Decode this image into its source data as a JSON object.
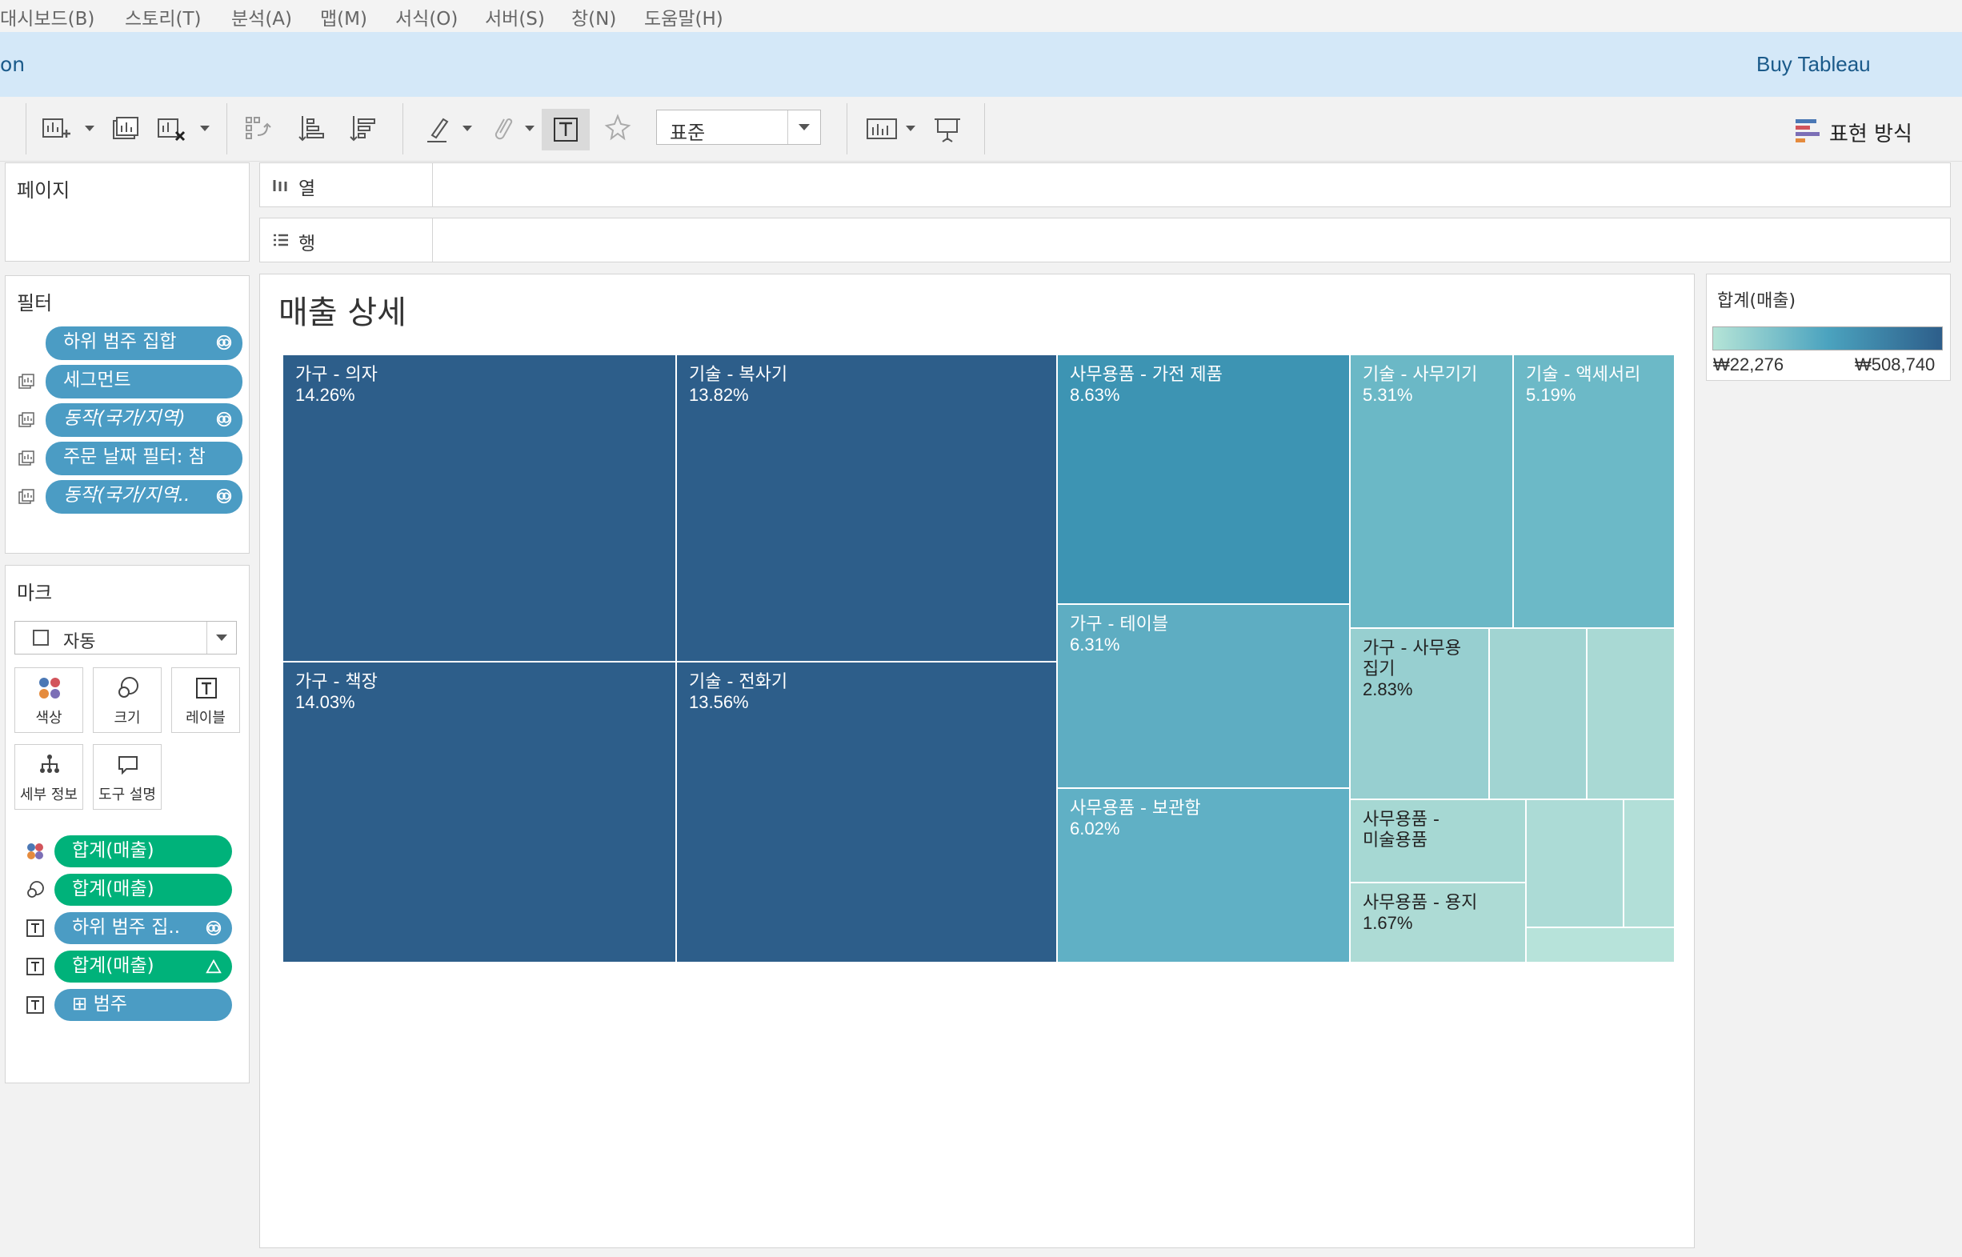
{
  "menu": [
    "대시보드(B)",
    "스토리(T)",
    "분석(A)",
    "맵(M)",
    "서식(O)",
    "서버(S)",
    "창(N)",
    "도움말(H)"
  ],
  "top_strip": {
    "left_text": "on",
    "buy": "Buy Tableau"
  },
  "toolbar": {
    "fit_value": "표준",
    "show_me": "표현 방식",
    "icons": [
      "new-worksheet-icon",
      "duplicate-sheet-icon",
      "clear-sheet-icon",
      "swap-rows-columns-icon",
      "sort-ascending-icon",
      "sort-descending-icon",
      "highlight-icon",
      "attach-icon",
      "show-mark-labels-icon",
      "pin-icon",
      "presentation-chart-icon",
      "present-mode-icon"
    ]
  },
  "shelves": {
    "pages": "페이지",
    "columns": "열",
    "rows": "행"
  },
  "filters": {
    "title": "필터",
    "items": [
      {
        "label": "하위 범주 집합",
        "italic": false,
        "icon": "set-icon",
        "side_icon": ""
      },
      {
        "label": "세그먼트",
        "italic": false,
        "icon": "",
        "side_icon": "context-filter-icon"
      },
      {
        "label": "동작(국가/지역)",
        "italic": true,
        "icon": "set-icon",
        "side_icon": "context-filter-icon"
      },
      {
        "label": "주문 날짜 필터: 참",
        "italic": false,
        "icon": "",
        "side_icon": "context-filter-icon"
      },
      {
        "label": "동작(국가/지역..",
        "italic": true,
        "icon": "set-icon",
        "side_icon": "context-filter-icon"
      }
    ]
  },
  "marks": {
    "title": "마크",
    "type": "자동",
    "buttons": [
      "색상",
      "크기",
      "레이블",
      "세부 정보",
      "도구 설명"
    ],
    "pills": [
      {
        "label": "합계(매출)",
        "color": "green",
        "icon": "color-icon",
        "right_icon": ""
      },
      {
        "label": "합계(매출)",
        "color": "green",
        "icon": "size-icon",
        "right_icon": ""
      },
      {
        "label": "하위 범주 집..",
        "color": "blue",
        "icon": "label-icon",
        "right_icon": "set-icon"
      },
      {
        "label": "합계(매출)",
        "color": "green",
        "icon": "label-icon",
        "right_icon": "delta-icon"
      },
      {
        "label": "⊞ 범주",
        "color": "blue",
        "icon": "label-icon",
        "right_icon": ""
      }
    ]
  },
  "view": {
    "title": "매출 상세"
  },
  "legend": {
    "title": "합계(매출)",
    "min": "₩22,276",
    "max": "₩508,740",
    "colors": [
      "#b5e4d7",
      "#4ba3bf",
      "#2d5e8a"
    ]
  },
  "chart_data": {
    "type": "treemap",
    "title": "매출 상세",
    "measure": "합계(매출)",
    "items": [
      {
        "label": "가구 - 의자",
        "value": "14.26%",
        "share": 14.26,
        "color": "#2d5e8a"
      },
      {
        "label": "가구 - 책장",
        "value": "14.03%",
        "share": 14.03,
        "color": "#2d5e8a"
      },
      {
        "label": "기술 - 복사기",
        "value": "13.82%",
        "share": 13.82,
        "color": "#2d5e8a"
      },
      {
        "label": "기술 - 전화기",
        "value": "13.56%",
        "share": 13.56,
        "color": "#2d5e8a"
      },
      {
        "label": "사무용품 - 가전 제품",
        "value": "8.63%",
        "share": 8.63,
        "color": "#3d94b3"
      },
      {
        "label": "가구 - 테이블",
        "value": "6.31%",
        "share": 6.31,
        "color": "#5eadc2"
      },
      {
        "label": "사무용품 - 보관함",
        "value": "6.02%",
        "share": 6.02,
        "color": "#60b0c5"
      },
      {
        "label": "기술 - 사무기기",
        "value": "5.31%",
        "share": 5.31,
        "color": "#6bb8c6"
      },
      {
        "label": "기술 - 액세서리",
        "value": "5.19%",
        "share": 5.19,
        "color": "#6cb9c7"
      },
      {
        "label": "가구 - 사무용 집기",
        "value": "2.83%",
        "share": 2.83,
        "color": "#97cfd0"
      },
      {
        "label": "",
        "value": "",
        "share": null,
        "color": "#a1d4d2"
      },
      {
        "label": "",
        "value": "",
        "share": null,
        "color": "#a9d9d4"
      },
      {
        "label": "사무용품 - 미술용품",
        "value": "",
        "share": null,
        "color": "#a6d8d3"
      },
      {
        "label": "사무용품 - 용지",
        "value": "1.67%",
        "share": 1.67,
        "color": "#addbd5"
      },
      {
        "label": "",
        "value": "",
        "share": null,
        "color": "#acdbd6"
      },
      {
        "label": "",
        "value": "",
        "share": null,
        "color": "#b2dfd8"
      },
      {
        "label": "",
        "value": "",
        "share": null,
        "color": "#b7e3da"
      }
    ]
  }
}
